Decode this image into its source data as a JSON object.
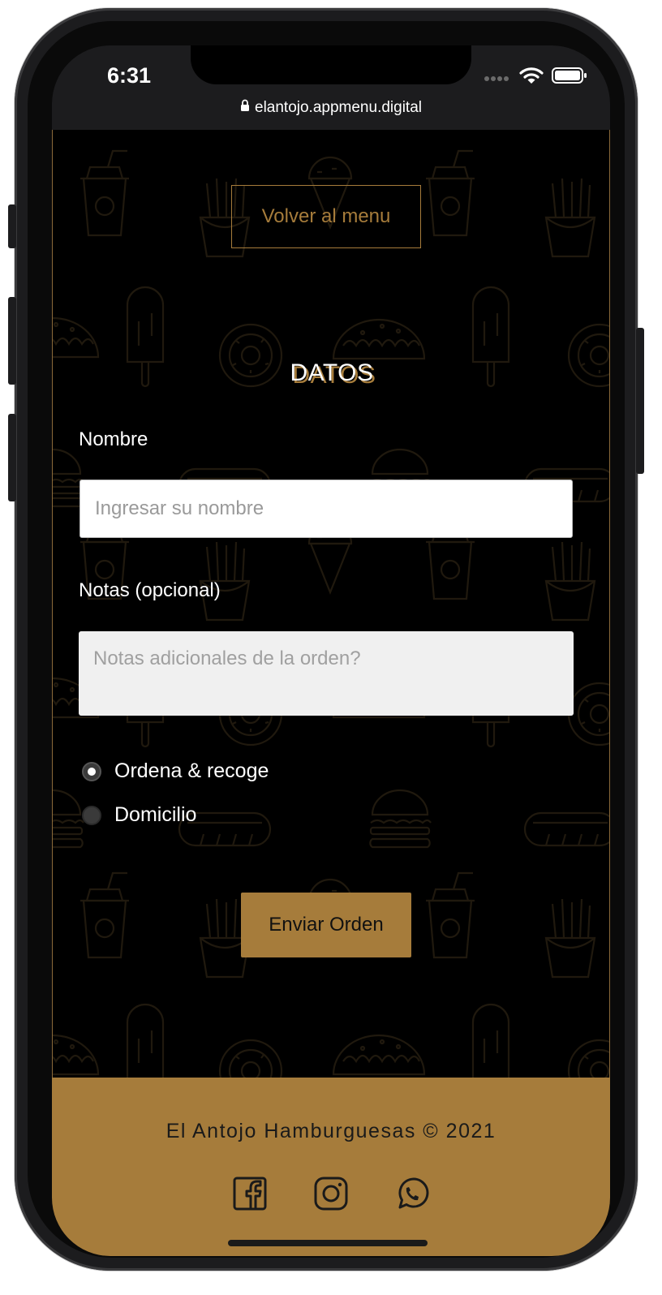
{
  "status_bar": {
    "time": "6:31",
    "url": "elantojo.appmenu.digital",
    "icons": [
      "signal-icon",
      "wifi-icon",
      "battery-icon",
      "lock-icon"
    ]
  },
  "header": {
    "back_button": "Volver al menu"
  },
  "form": {
    "title": "DATOS",
    "name_label": "Nombre",
    "name_placeholder": "Ingresar su nombre",
    "notes_label": "Notas (opcional)",
    "notes_placeholder": "Notas adicionales de la orden?",
    "delivery_options": [
      {
        "label": "Ordena & recoge",
        "selected": true
      },
      {
        "label": "Domicilio",
        "selected": false
      }
    ],
    "submit_label": "Enviar Orden"
  },
  "footer": {
    "copyright": "El Antojo Hamburguesas © 2021",
    "social_icons": [
      "facebook-icon",
      "instagram-icon",
      "whatsapp-icon"
    ]
  },
  "colors": {
    "accent": "#a67c3b",
    "background": "#000000",
    "text": "#ffffff"
  }
}
